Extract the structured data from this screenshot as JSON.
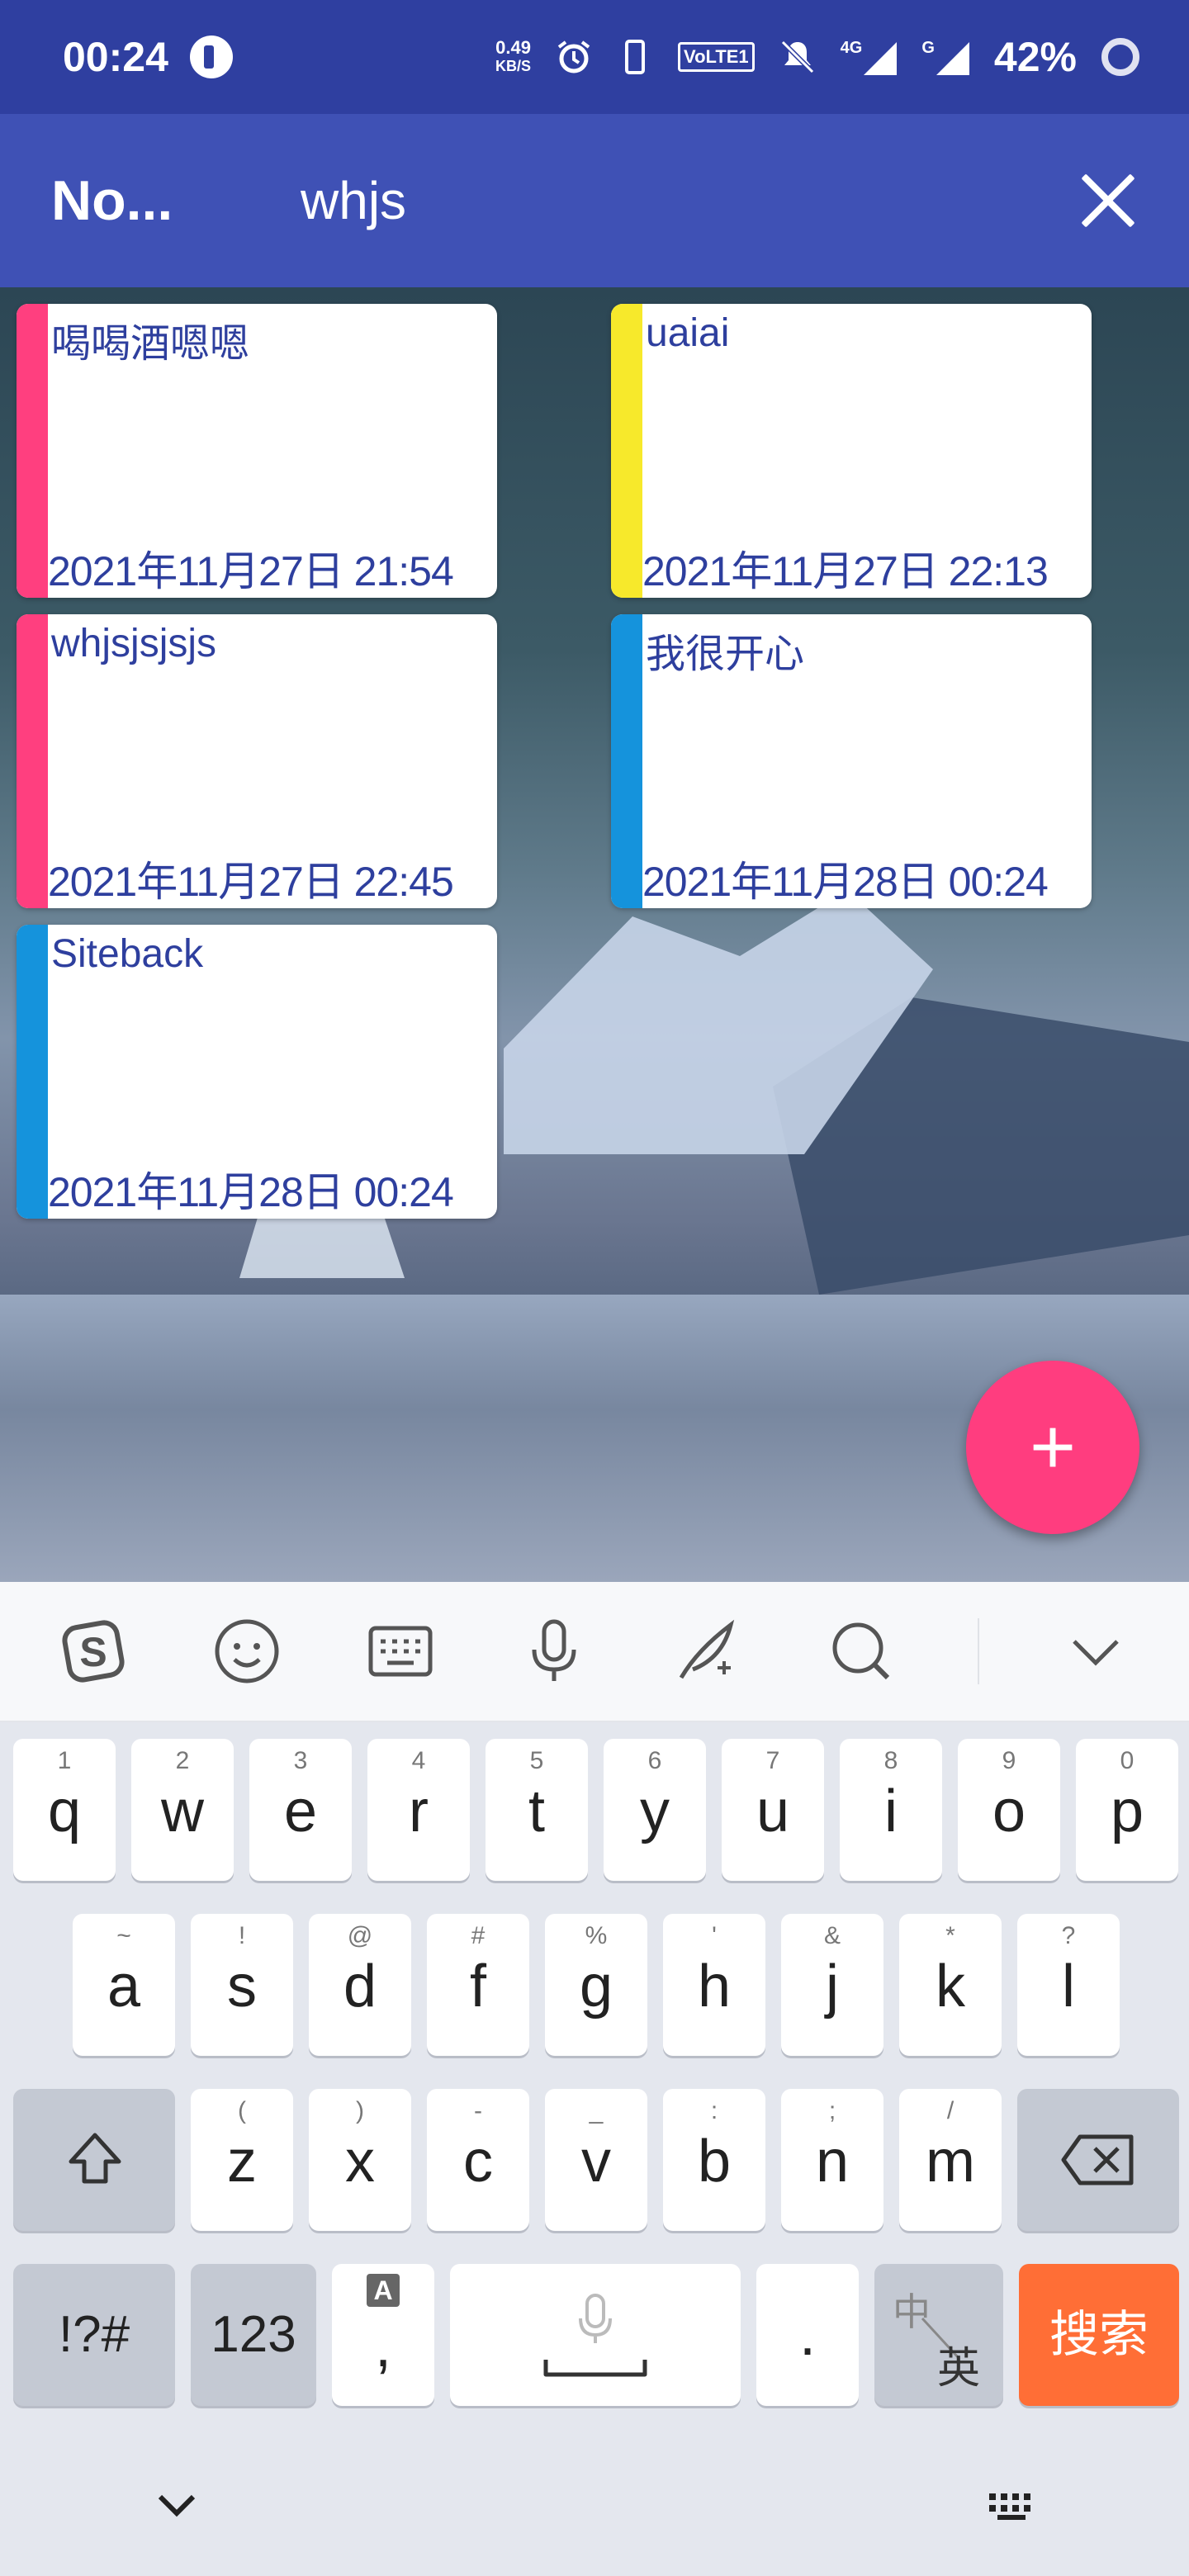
{
  "status_bar": {
    "time": "00:24",
    "net_speed_value": "0.49",
    "net_speed_unit": "KB/S",
    "signal_4g": "4G",
    "signal_g": "G",
    "volte": "VoLTE1",
    "battery": "42%"
  },
  "toolbar": {
    "title": "No...",
    "search_value": "whjs",
    "close_icon": "close-icon"
  },
  "notes": [
    {
      "title": "喝喝酒嗯嗯",
      "date": "2021年11月27日 21:54",
      "color": "#ff3f7f"
    },
    {
      "title": "uaiai",
      "date": "2021年11月27日 22:13",
      "color": "#f7e92b"
    },
    {
      "title": "whjsjsjsjs",
      "date": "2021年11月27日 22:45",
      "color": "#ff3f7f"
    },
    {
      "title": "我很开心",
      "date": "2021年11月28日 00:24",
      "color": "#1593dc"
    },
    {
      "title": "Siteback",
      "date": "2021年11月28日 00:24",
      "color": "#1593dc"
    }
  ],
  "fab": {
    "label": "+"
  },
  "keyboard": {
    "toolbar_icons": [
      "sogou-logo-icon",
      "emoji-icon",
      "keyboard-icon",
      "microphone-icon",
      "handwriting-icon",
      "search-icon",
      "collapse-icon"
    ],
    "row1": [
      {
        "hint": "1",
        "key": "q"
      },
      {
        "hint": "2",
        "key": "w"
      },
      {
        "hint": "3",
        "key": "e"
      },
      {
        "hint": "4",
        "key": "r"
      },
      {
        "hint": "5",
        "key": "t"
      },
      {
        "hint": "6",
        "key": "y"
      },
      {
        "hint": "7",
        "key": "u"
      },
      {
        "hint": "8",
        "key": "i"
      },
      {
        "hint": "9",
        "key": "o"
      },
      {
        "hint": "0",
        "key": "p"
      }
    ],
    "row2": [
      {
        "hint": "~",
        "key": "a"
      },
      {
        "hint": "!",
        "key": "s"
      },
      {
        "hint": "@",
        "key": "d"
      },
      {
        "hint": "#",
        "key": "f"
      },
      {
        "hint": "%",
        "key": "g"
      },
      {
        "hint": "'",
        "key": "h"
      },
      {
        "hint": "&",
        "key": "j"
      },
      {
        "hint": "*",
        "key": "k"
      },
      {
        "hint": "?",
        "key": "l"
      }
    ],
    "row3": [
      {
        "hint": "(",
        "key": "z"
      },
      {
        "hint": ")",
        "key": "x"
      },
      {
        "hint": "-",
        "key": "c"
      },
      {
        "hint": "_",
        "key": "v"
      },
      {
        "hint": ":",
        "key": "b"
      },
      {
        "hint": ";",
        "key": "n"
      },
      {
        "hint": "/",
        "key": "m"
      }
    ],
    "symbols_label": "!?#",
    "numbers_label": "123",
    "comma_hint": "A",
    "comma_label": ",",
    "period_label": ".",
    "lang_top": "中",
    "lang_bottom": "英",
    "search_label": "搜索"
  }
}
